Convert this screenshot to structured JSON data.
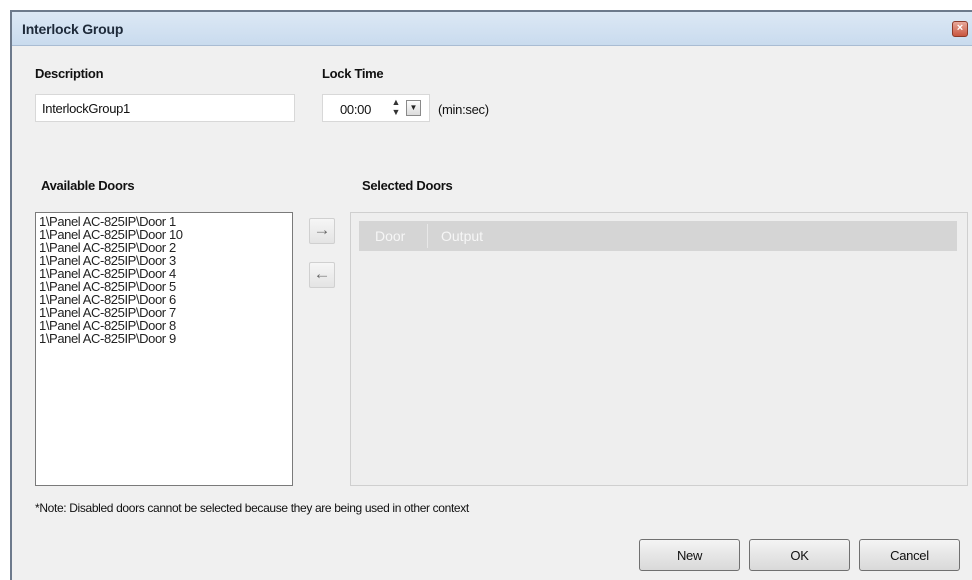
{
  "window": {
    "title": "Interlock Group",
    "close_glyph": "×"
  },
  "form": {
    "description_label": "Description",
    "description_value": "InterlockGroup1",
    "lock_time_label": "Lock Time",
    "lock_time_value": "00:00",
    "lock_time_unit": "(min:sec)"
  },
  "available": {
    "label": "Available Doors",
    "items": [
      "1\\Panel  AC-825IP\\Door 1",
      "1\\Panel  AC-825IP\\Door 10",
      "1\\Panel  AC-825IP\\Door 2",
      "1\\Panel  AC-825IP\\Door 3",
      "1\\Panel  AC-825IP\\Door 4",
      "1\\Panel  AC-825IP\\Door 5",
      "1\\Panel  AC-825IP\\Door 6",
      "1\\Panel  AC-825IP\\Door 7",
      "1\\Panel  AC-825IP\\Door 8",
      "1\\Panel  AC-825IP\\Door 9"
    ]
  },
  "transfer": {
    "add_glyph": "→",
    "remove_glyph": "←"
  },
  "selected": {
    "label": "Selected Doors",
    "columns": [
      "Door",
      "Output"
    ]
  },
  "note": "*Note: Disabled doors cannot be selected because they are being used in other context",
  "buttons": {
    "new": "New",
    "ok": "OK",
    "cancel": "Cancel"
  },
  "icons": {
    "close": "close-icon",
    "spin_up": "chevron-up-icon",
    "spin_down": "chevron-down-icon",
    "dropdown": "dropdown-arrow-icon",
    "add": "arrow-right-icon",
    "remove": "arrow-left-icon"
  }
}
